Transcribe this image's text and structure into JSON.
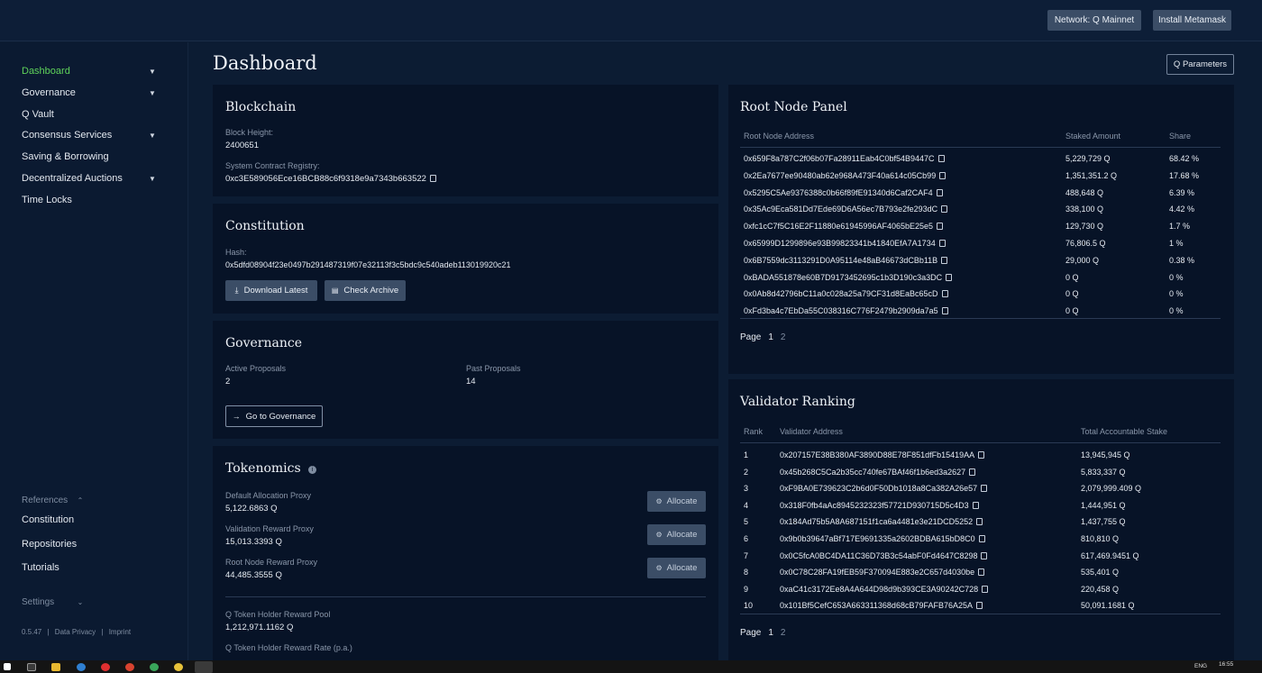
{
  "topbar": {
    "network_label": "Network: Q Mainnet",
    "metamask_label": "Install Metamask"
  },
  "sidebar": {
    "items": [
      {
        "label": "Dashboard",
        "chevron": true,
        "active": true
      },
      {
        "label": "Governance",
        "chevron": true
      },
      {
        "label": "Q Vault",
        "chevron": false
      },
      {
        "label": "Consensus Services",
        "chevron": true
      },
      {
        "label": "Saving & Borrowing",
        "chevron": false
      },
      {
        "label": "Decentralized Auctions",
        "chevron": true
      },
      {
        "label": "Time Locks",
        "chevron": false
      }
    ],
    "references_label": "References",
    "reference_links": [
      "Constitution",
      "Repositories",
      "Tutorials"
    ],
    "settings_label": "Settings",
    "footer": {
      "version": "0.5.47",
      "privacy": "Data Privacy",
      "imprint": "Imprint"
    }
  },
  "page": {
    "title": "Dashboard",
    "q_params_label": "Q Parameters"
  },
  "blockchain": {
    "title": "Blockchain",
    "block_height_label": "Block Height:",
    "block_height": "2400651",
    "registry_label": "System Contract Registry:",
    "registry": "0xc3E589056Ece16BCB88c6f9318e9a7343b663522"
  },
  "constitution": {
    "title": "Constitution",
    "hash_label": "Hash:",
    "hash": "0x5dfd08904f23e0497b291487319f07e32113f3c5bdc9c540adeb113019920c21",
    "download_label": "Download Latest",
    "archive_label": "Check Archive"
  },
  "governance": {
    "title": "Governance",
    "active_label": "Active Proposals",
    "active_value": "2",
    "past_label": "Past Proposals",
    "past_value": "14",
    "go_label": "Go to Governance"
  },
  "tokenomics": {
    "title": "Tokenomics",
    "proxies": [
      {
        "label": "Default Allocation Proxy",
        "value": "5,122.6863 Q"
      },
      {
        "label": "Validation Reward Proxy",
        "value": "15,013.3393 Q"
      },
      {
        "label": "Root Node Reward Proxy",
        "value": "44,485.3555 Q"
      }
    ],
    "allocate_label": "Allocate",
    "pool_label": "Q Token Holder Reward Pool",
    "pool_value": "1,212,971.1162 Q",
    "rate_label": "Q Token Holder Reward Rate (p.a.)"
  },
  "root_nodes": {
    "title": "Root Node Panel",
    "headers": [
      "Root Node Address",
      "Staked Amount",
      "Share"
    ],
    "rows": [
      [
        "0x659F8a787C2f06b07Fa28911Eab4C0bf54B9447C",
        "5,229,729 Q",
        "68.42 %"
      ],
      [
        "0x2Ea7677ee90480ab62e968A473F40a614c05Cb99",
        "1,351,351.2 Q",
        "17.68 %"
      ],
      [
        "0x5295C5Ae9376388c0b66f89fE91340d6Caf2CAF4",
        "488,648 Q",
        "6.39 %"
      ],
      [
        "0x35Ac9Eca581Dd7Ede69D6A56ec7B793e2fe293dC",
        "338,100 Q",
        "4.42 %"
      ],
      [
        "0xfc1cC7f5C16E2F11880e61945996AF4065bE25e5",
        "129,730 Q",
        "1.7 %"
      ],
      [
        "0x65999D1299896e93B99823341b41840EfA7A1734",
        "76,806.5 Q",
        "1 %"
      ],
      [
        "0x6B7559dc3113291D0A95114e48aB46673dCBb11B",
        "29,000 Q",
        "0.38 %"
      ],
      [
        "0xBADA551878e60B7D9173452695c1b3D190c3a3DC",
        "0 Q",
        "0 %"
      ],
      [
        "0x0Ab8d42796bC11a0c028a25a79CF31d8EaBc65cD",
        "0 Q",
        "0 %"
      ],
      [
        "0xFd3ba4c7EbDa55C038316C776F2479b2909da7a5",
        "0 Q",
        "0 %"
      ]
    ],
    "page_label": "Page",
    "pages": [
      "1",
      "2"
    ]
  },
  "validators": {
    "title": "Validator Ranking",
    "headers": [
      "Rank",
      "Validator Address",
      "Total Accountable Stake"
    ],
    "rows": [
      [
        "1",
        "0x207157E38B380AF3890D88E78F851dfFb15419AA",
        "13,945,945 Q"
      ],
      [
        "2",
        "0x45b268C5Ca2b35cc740fe67BAf46f1b6ed3a2627",
        "5,833,337 Q"
      ],
      [
        "3",
        "0xF9BA0E739623C2b6d0F50Db1018a8Ca382A26e57",
        "2,079,999.409 Q"
      ],
      [
        "4",
        "0x318F0fb4aAc8945232323f57721D930715D5c4D3",
        "1,444,951 Q"
      ],
      [
        "5",
        "0x184Ad75b5A8A687151f1ca6a4481e3e21DCD5252",
        "1,437,755 Q"
      ],
      [
        "6",
        "0x9b0b39647aBf717E9691335a2602BDBA615bD8C0",
        "810,810 Q"
      ],
      [
        "7",
        "0x0C5fcA0BC4DA11C36D73B3c54abF0Fd4647C8298",
        "617,469.9451 Q"
      ],
      [
        "8",
        "0x0C78C28FA19fEB59F370094E883e2C657d4030be",
        "535,401 Q"
      ],
      [
        "9",
        "0xaC41c3172Ee8A4A644D98d9b393CE3A90242C728",
        "220,458 Q"
      ],
      [
        "10",
        "0x101Bf5CefC653A663311368d68cB79FAFB76A25A",
        "50,091.1681 Q"
      ]
    ],
    "page_label": "Page",
    "pages": [
      "1",
      "2"
    ]
  },
  "taskbar": {
    "lang": "ENG",
    "time": "16:55"
  },
  "colors": {
    "accent_green": "#5fd35a",
    "background": "#0c1c33",
    "card": "#071327",
    "button": "#3b4d66"
  }
}
